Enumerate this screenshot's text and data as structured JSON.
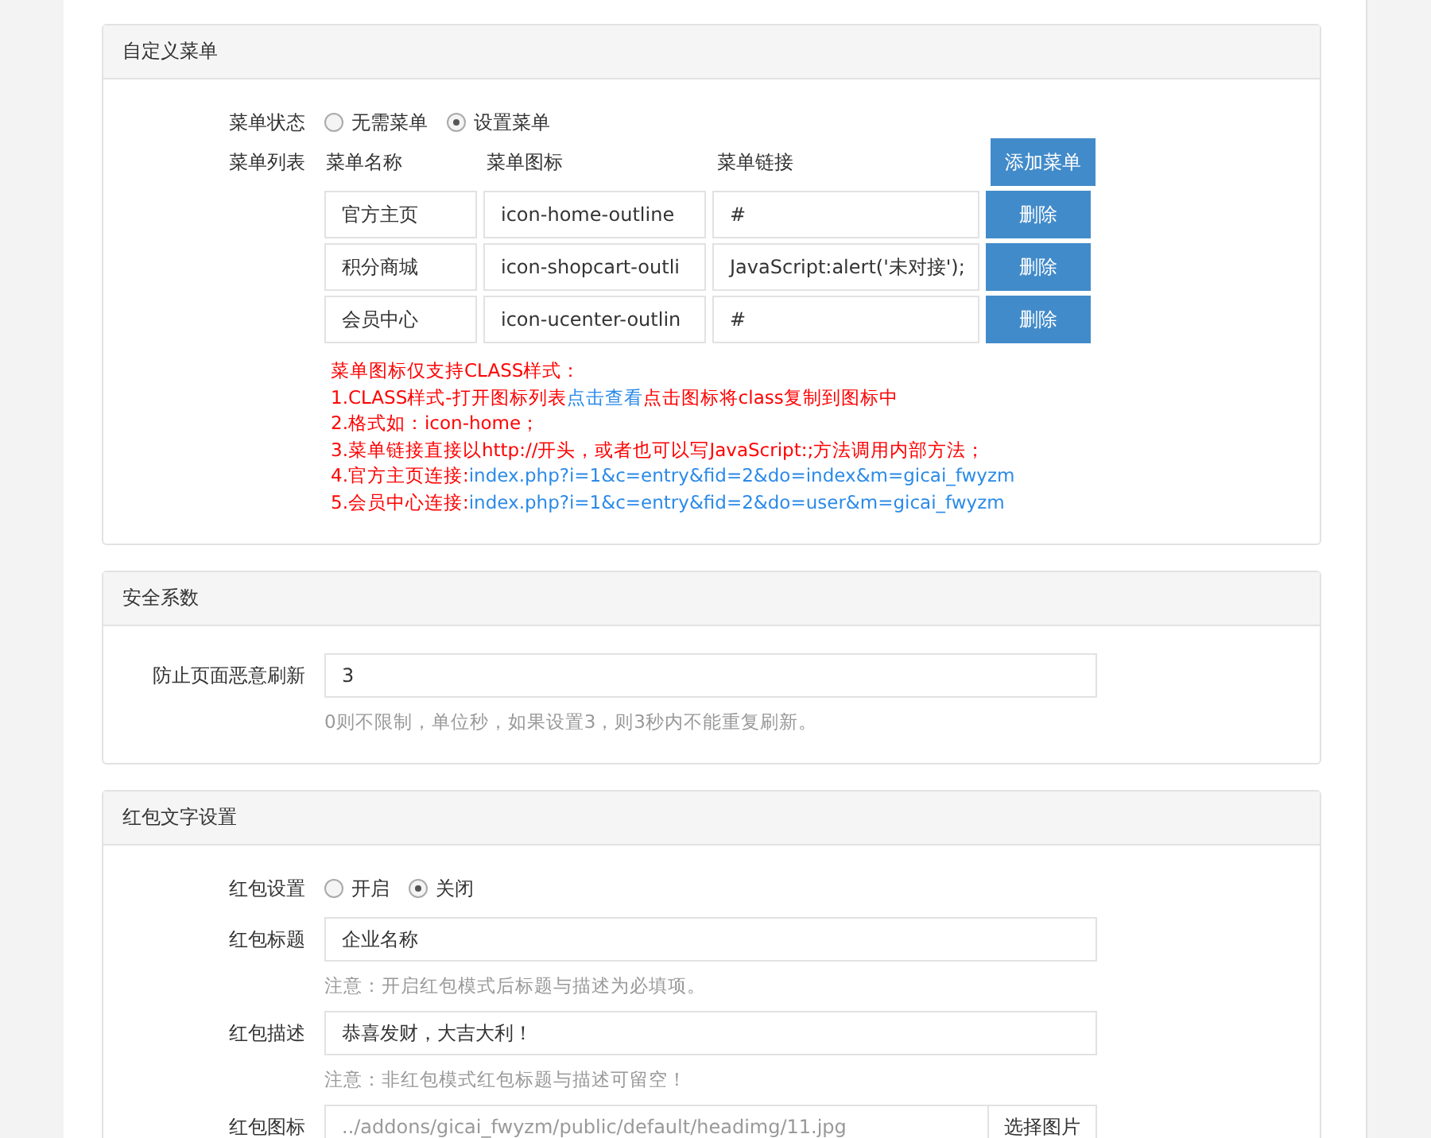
{
  "panels": [
    {
      "kind": "menu",
      "title": "自定义菜单",
      "status": {
        "label": "菜单状态",
        "options": [
          {
            "label": "无需菜单",
            "selected": false
          },
          {
            "label": "设置菜单",
            "selected": true
          }
        ]
      },
      "list": {
        "label": "菜单列表",
        "columns": [
          "菜单名称",
          "菜单图标",
          "菜单链接"
        ],
        "add_button": "添加菜单",
        "rows": [
          {
            "name": "官方主页",
            "icon": "icon-home-outline",
            "link": "#",
            "button": "删除"
          },
          {
            "name": "积分商城",
            "icon": "icon-shopcart-outli",
            "link": "JavaScript:alert('未对接');",
            "button": "删除"
          },
          {
            "name": "会员中心",
            "icon": "icon-ucenter-outlin",
            "link": "#",
            "button": "删除"
          }
        ]
      },
      "notes": [
        [
          {
            "text": "菜单图标仅支持CLASS样式：",
            "link": false
          }
        ],
        [
          {
            "text": "1.CLASS样式-打开图标列表",
            "link": false
          },
          {
            "text": "点击查看",
            "link": true
          },
          {
            "text": "点击图标将class复制到图标中",
            "link": false
          }
        ],
        [
          {
            "text": "2.格式如：icon-home；",
            "link": false
          }
        ],
        [
          {
            "text": "3.菜单链接直接以http://开头，或者也可以写JavaScript:;方法调用内部方法；",
            "link": false
          }
        ],
        [
          {
            "text": "4.官方主页连接:",
            "link": false
          },
          {
            "text": "index.php?i=1&c=entry&fid=2&do=index&m=gicai_fwyzm",
            "link": true
          }
        ],
        [
          {
            "text": "5.会员中心连接:",
            "link": false
          },
          {
            "text": "index.php?i=1&c=entry&fid=2&do=user&m=gicai_fwyzm",
            "link": true
          }
        ]
      ]
    },
    {
      "kind": "form",
      "title": "安全系数",
      "fields": [
        {
          "kind": "input",
          "label": "防止页面恶意刷新",
          "value": "3",
          "help": "0则不限制，单位秒，如果设置3，则3秒内不能重复刷新。"
        }
      ]
    },
    {
      "kind": "form",
      "title": "红包文字设置",
      "fields": [
        {
          "kind": "radio",
          "label": "红包设置",
          "options": [
            {
              "label": "开启",
              "selected": false
            },
            {
              "label": "关闭",
              "selected": true
            }
          ]
        },
        {
          "kind": "input",
          "label": "红包标题",
          "value": "企业名称",
          "help": "注意：开启红包模式后标题与描述为必填项。"
        },
        {
          "kind": "input",
          "label": "红包描述",
          "value": "恭喜发财，大吉大利！",
          "help": "注意：非红包模式红包标题与描述可留空！"
        },
        {
          "kind": "file",
          "label": "红包图标",
          "placeholder": "../addons/gicai_fwyzm/public/default/headimg/11.jpg",
          "button": "选择图片"
        }
      ]
    }
  ]
}
